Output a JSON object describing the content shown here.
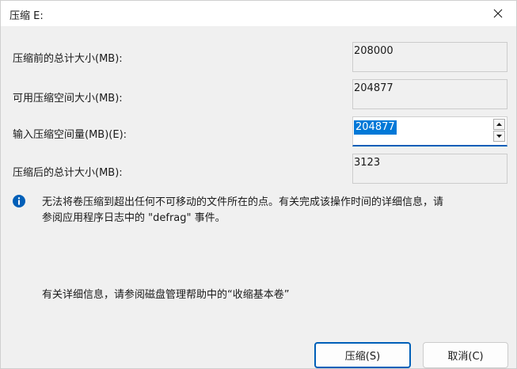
{
  "window": {
    "title": "压缩 E:"
  },
  "fields": {
    "total_before": {
      "label": "压缩前的总计大小(MB):",
      "value": "208000"
    },
    "available": {
      "label": "可用压缩空间大小(MB):",
      "value": "204877"
    },
    "shrink_amount": {
      "label": "输入压缩空间量(MB)(E):",
      "value": "204877"
    },
    "total_after": {
      "label": "压缩后的总计大小(MB):",
      "value": "3123"
    }
  },
  "info": {
    "icon": "info-icon",
    "line1": "无法将卷压缩到超出任何不可移动的文件所在的点。有关完成该操作时间的详细信息，请",
    "line2": "参阅应用程序日志中的 \"defrag\" 事件。"
  },
  "help": {
    "text": "有关详细信息，请参阅磁盘管理帮助中的“收缩基本卷”"
  },
  "buttons": {
    "shrink": "压缩(S)",
    "cancel": "取消(C)"
  },
  "colors": {
    "accent": "#005fb8",
    "selection": "#0078d7",
    "info_icon": "#005fb8",
    "dialog_bg": "#f0f0f0"
  }
}
